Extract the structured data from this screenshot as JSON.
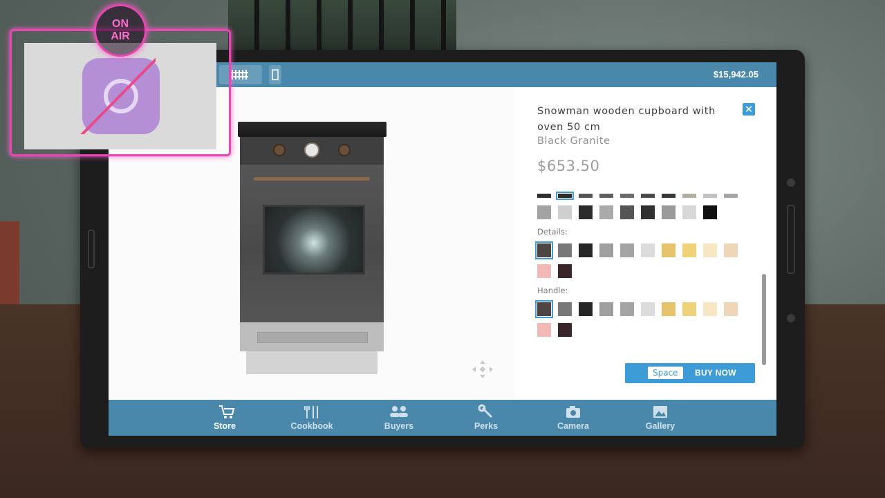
{
  "overlay": {
    "on_air_line1": "ON",
    "on_air_line2": "AIR"
  },
  "topbar": {
    "balance": "$15,942.05"
  },
  "product": {
    "title": "Snowman wooden cupboard with oven 50 cm",
    "variant": "Black Granite",
    "price": "$653.50"
  },
  "sections": {
    "details_label": "Details:",
    "handle_label": "Handle:"
  },
  "swatches": {
    "top_row_colors": [
      "#2e2e2e",
      "#2a2a2a",
      "#555555",
      "#5e5e5e",
      "#6a6a6a",
      "#4a4a4a",
      "#393939",
      "#b5ada2",
      "#c2c2c2",
      "#a6a6a6"
    ],
    "body_row_colors": [
      "#a3a3a3",
      "#cfcfcf",
      "#2b2b2b",
      "#aaaaaa",
      "#555555",
      "#2f2f2f",
      "#9a9a9a",
      "#d7d7d7",
      "#101010"
    ],
    "details_colors": [
      "#4e4644",
      "#787878",
      "#262626",
      "#9f9f9f",
      "#a4a4a4",
      "#dcdcdc",
      "#e6c36a",
      "#f0d278",
      "#f6e7c2",
      "#f0d6b8",
      "#f3b9b6",
      "#3a2628"
    ],
    "handle_colors": [
      "#4e4644",
      "#787878",
      "#262626",
      "#9f9f9f",
      "#a4a4a4",
      "#dcdcdc",
      "#e6c36a",
      "#f0d278",
      "#f6e7c2",
      "#f0d6b8",
      "#f3b9b6",
      "#3a2628"
    ]
  },
  "buy": {
    "key": "Space",
    "label": "BUY NOW"
  },
  "nav": {
    "store": "Store",
    "cookbook": "Cookbook",
    "buyers": "Buyers",
    "perks": "Perks",
    "camera": "Camera",
    "gallery": "Gallery"
  },
  "colors": {
    "accent": "#3d9bd6",
    "bar": "#4a88ab",
    "onair": "#e846b3"
  },
  "icons": {
    "store": "cart-icon",
    "cookbook": "utensils-icon",
    "buyers": "people-icon",
    "perks": "wrench-icon",
    "camera": "camera-icon",
    "gallery": "image-icon",
    "close": "close-icon",
    "rotate": "rotate-arrows-icon"
  }
}
